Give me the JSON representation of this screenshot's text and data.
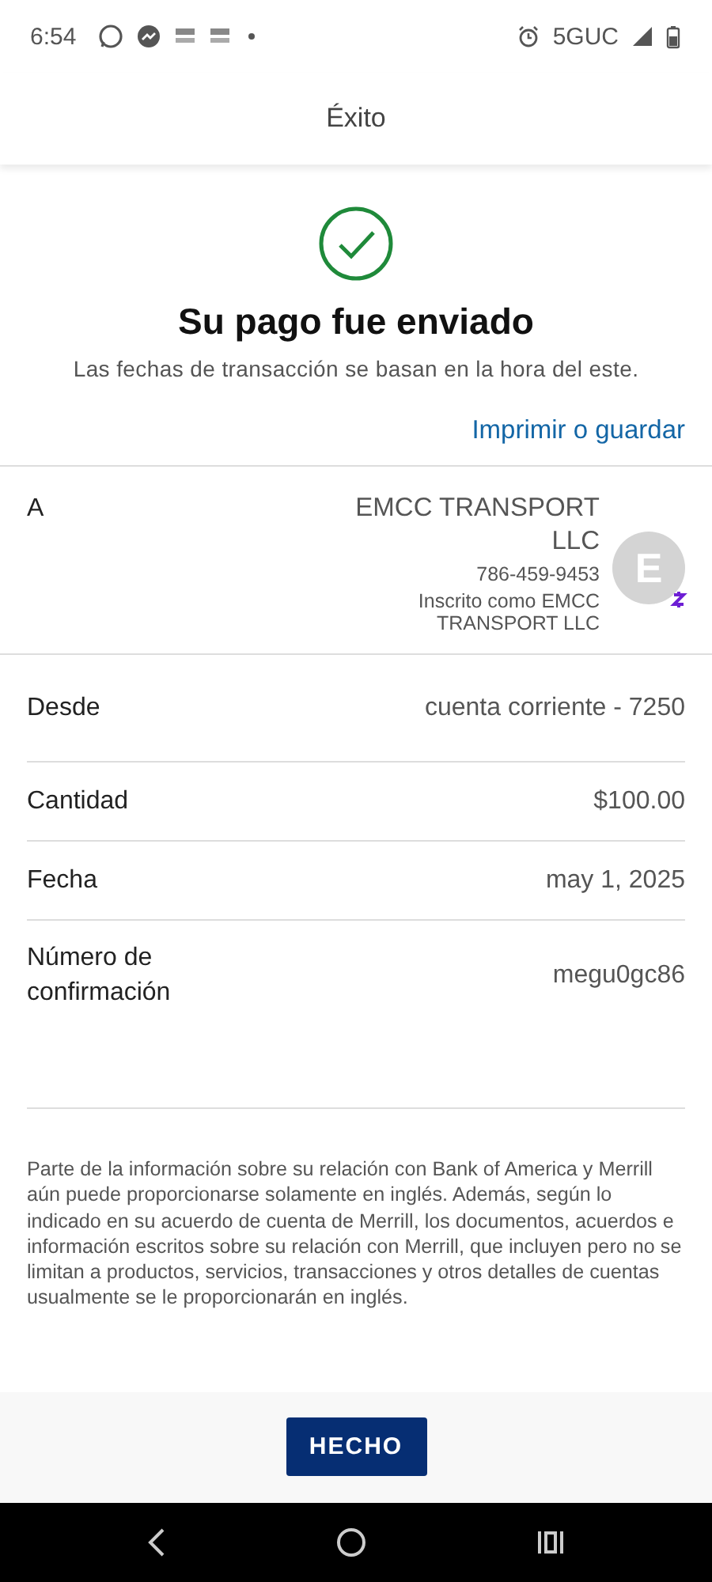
{
  "status_bar": {
    "time": "6:54",
    "network": "5GUC"
  },
  "header": {
    "title": "Éxito"
  },
  "summary": {
    "title": "Su pago fue enviado",
    "subtitle": "Las fechas de transacción se basan en la hora del este.",
    "link": "Imprimir o guardar"
  },
  "details": [
    {
      "kind": "recipient",
      "label": "A",
      "name": "EMCC TRANSPORT LLC",
      "phone": "786-459-9453",
      "enrolled": "Inscrito como EMCC TRANSPORT LLC",
      "avatar": "E"
    },
    {
      "kind": "plain",
      "label": "Desde",
      "value": "cuenta corriente - 7250"
    },
    {
      "kind": "plain",
      "label": "Cantidad",
      "value": "$100.00"
    },
    {
      "kind": "plain",
      "label": "Fecha",
      "value": "may 1, 2025"
    },
    {
      "kind": "plain",
      "label": "Número de confirmación",
      "value": "megu0gc86"
    }
  ],
  "disclaimer": "Parte de la información sobre su relación con Bank of America y Merrill aún puede proporcionarse solamente en inglés. Además, según lo indicado en su acuerdo de cuenta de Merrill, los documentos, acuerdos e información escritos sobre su relación con Merrill, que incluyen pero no se limitan a productos, servicios, transacciones y otros detalles de cuentas usualmente se le proporcionarán en inglés.",
  "button": {
    "label": "HECHO"
  }
}
